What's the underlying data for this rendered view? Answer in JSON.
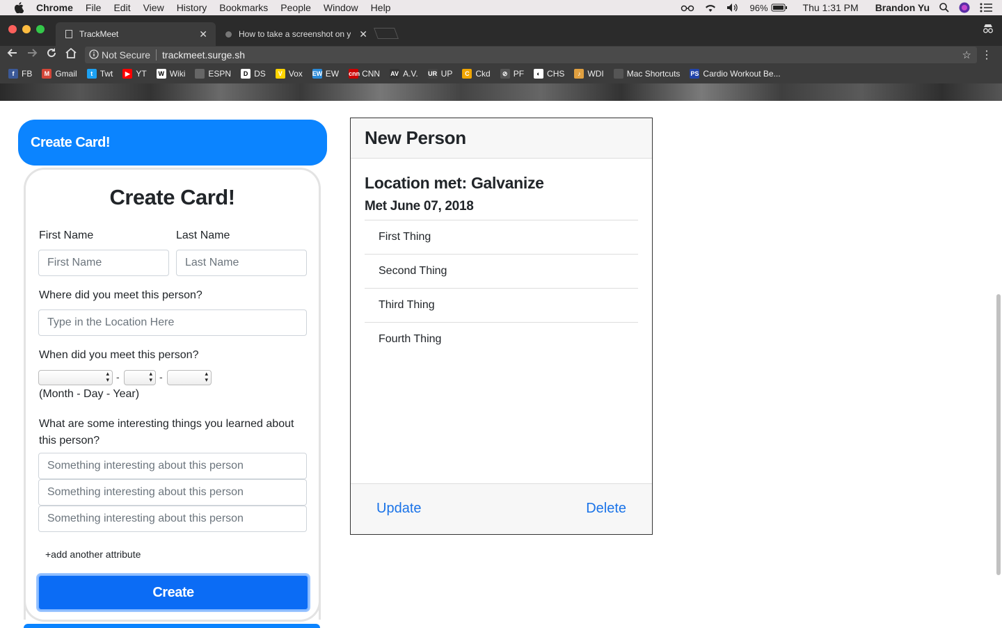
{
  "menubar": {
    "app": "Chrome",
    "items": [
      "File",
      "Edit",
      "View",
      "History",
      "Bookmarks",
      "People",
      "Window",
      "Help"
    ],
    "battery": "96%",
    "clock": "Thu 1:31 PM",
    "user": "Brandon Yu"
  },
  "tabs": [
    {
      "title": "TrackMeet"
    },
    {
      "title": "How to take a screenshot on y"
    }
  ],
  "toolbar": {
    "security": "Not Secure",
    "url": "trackmeet.surge.sh"
  },
  "bookmarks": [
    {
      "label": "FB",
      "color": "#3b5998",
      "glyph": "f"
    },
    {
      "label": "Gmail",
      "color": "#d44638",
      "glyph": "M"
    },
    {
      "label": "Twt",
      "color": "#1da1f2",
      "glyph": "t"
    },
    {
      "label": "YT",
      "color": "#ff0000",
      "glyph": "▶"
    },
    {
      "label": "Wiki",
      "color": "#ffffff",
      "glyph": "W"
    },
    {
      "label": "ESPN",
      "color": "#666666",
      "glyph": ""
    },
    {
      "label": "DS",
      "color": "#ffffff",
      "glyph": "D"
    },
    {
      "label": "Vox",
      "color": "#ffd400",
      "glyph": "V"
    },
    {
      "label": "EW",
      "color": "#2b8ad8",
      "glyph": "EW"
    },
    {
      "label": "CNN",
      "color": "#cc0000",
      "glyph": "cnn"
    },
    {
      "label": "A.V.",
      "color": "#333333",
      "glyph": "AV"
    },
    {
      "label": "UP",
      "color": "#444444",
      "glyph": "UR"
    },
    {
      "label": "Ckd",
      "color": "#f0a500",
      "glyph": "C"
    },
    {
      "label": "PF",
      "color": "#555555",
      "glyph": "⊘"
    },
    {
      "label": "CHS",
      "color": "#ffffff",
      "glyph": "◐"
    },
    {
      "label": "WDI",
      "color": "#e0a040",
      "glyph": "♪"
    },
    {
      "label": "Mac Shortcuts",
      "color": "#555555",
      "glyph": ""
    },
    {
      "label": "Cardio Workout Be...",
      "color": "#2244aa",
      "glyph": "PS"
    }
  ],
  "create_banner": {
    "label": "Create Card!"
  },
  "form": {
    "title": "Create Card!",
    "first_name_label": "First Name",
    "first_name_placeholder": "First Name",
    "last_name_label": "Last Name",
    "last_name_placeholder": "Last Name",
    "location_label": "Where did you meet this person?",
    "location_placeholder": "Type in the Location Here",
    "date_label": "When did you meet this person?",
    "date_hint": "(Month - Day - Year)",
    "date_sep": "-",
    "facts_label": "What are some interesting things you learned about this person?",
    "fact_placeholder": "Something interesting about this person",
    "add_attribute": "+add another attribute",
    "create_button": "Create"
  },
  "person_card": {
    "name": "New Person",
    "location": "Location met: Galvanize",
    "met": "Met June 07, 2018",
    "facts": [
      "First Thing",
      "Second Thing",
      "Third Thing",
      "Fourth Thing"
    ],
    "update": "Update",
    "delete": "Delete"
  },
  "colors": {
    "primary": "#0b84ff",
    "button": "#0b6cf5",
    "link": "#1a73e8"
  }
}
